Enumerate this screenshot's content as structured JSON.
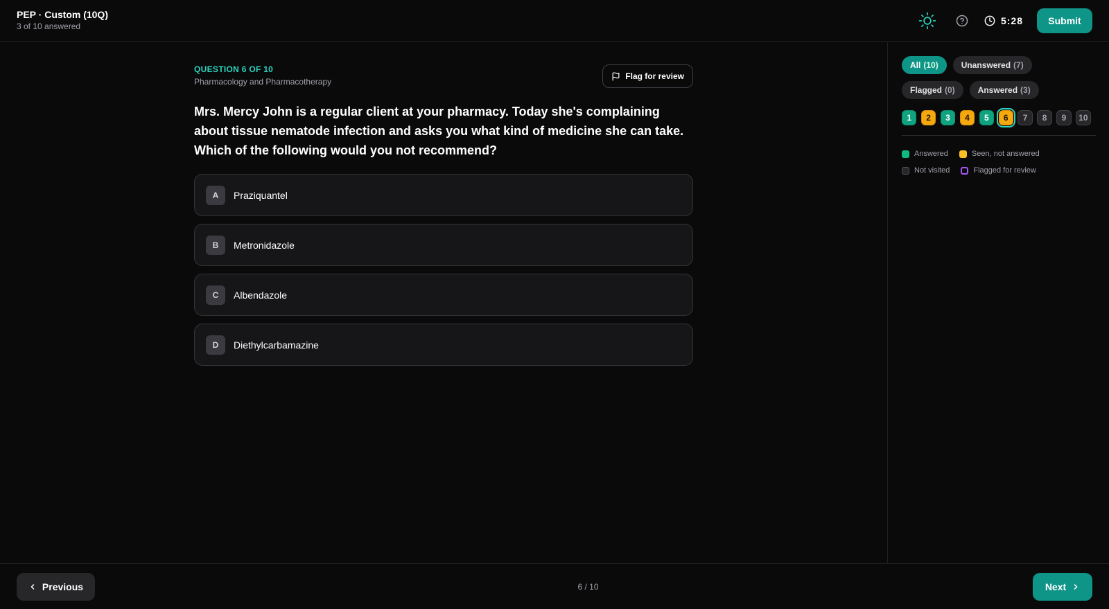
{
  "header": {
    "title": "PEP · Custom (10Q)",
    "subtitle": "3 of 10 answered",
    "theme_icon": "sun-icon",
    "help_icon": "help-circle-icon",
    "timer_icon": "clock-icon",
    "timer": "5:28",
    "submit_label": "Submit",
    "accent_color": "#0f9488"
  },
  "question": {
    "number_label": "QUESTION 6 OF 10",
    "category": "Pharmacology and Pharmacotherapy",
    "flag_label": "Flag for review",
    "text": "Mrs. Mercy John is a regular client at your pharmacy. Today she's complaining about tissue nematode infection and asks you what kind of medicine she can take. Which of the following would you not recommend?",
    "options": [
      {
        "letter": "A",
        "text": "Praziquantel"
      },
      {
        "letter": "B",
        "text": "Metronidazole"
      },
      {
        "letter": "C",
        "text": "Albendazole"
      },
      {
        "letter": "D",
        "text": "Diethylcarbamazine"
      }
    ]
  },
  "sidebar": {
    "filters": [
      {
        "label": "All",
        "count": "(10)",
        "active": true
      },
      {
        "label": "Unanswered",
        "count": "(7)",
        "active": false
      },
      {
        "label": "Flagged",
        "count": "(0)",
        "active": false
      },
      {
        "label": "Answered",
        "count": "(3)",
        "active": false
      }
    ],
    "questions": [
      {
        "n": "1",
        "state": "answered"
      },
      {
        "n": "2",
        "state": "seen"
      },
      {
        "n": "3",
        "state": "answered"
      },
      {
        "n": "4",
        "state": "seen"
      },
      {
        "n": "5",
        "state": "answered"
      },
      {
        "n": "6",
        "state": "seen",
        "current": true
      },
      {
        "n": "7",
        "state": "unvisited"
      },
      {
        "n": "8",
        "state": "unvisited"
      },
      {
        "n": "9",
        "state": "unvisited"
      },
      {
        "n": "10",
        "state": "unvisited"
      }
    ],
    "legend": {
      "answered": "Answered",
      "seen": "Seen, not answered",
      "unvisited": "Not visited",
      "flagged": "Flagged for review"
    },
    "colors": {
      "answered": "#10b981",
      "seen": "#fbbf24",
      "flagged": "#a855f7"
    }
  },
  "footer": {
    "prev_label": "Previous",
    "page_indicator": "6 / 10",
    "next_label": "Next"
  }
}
